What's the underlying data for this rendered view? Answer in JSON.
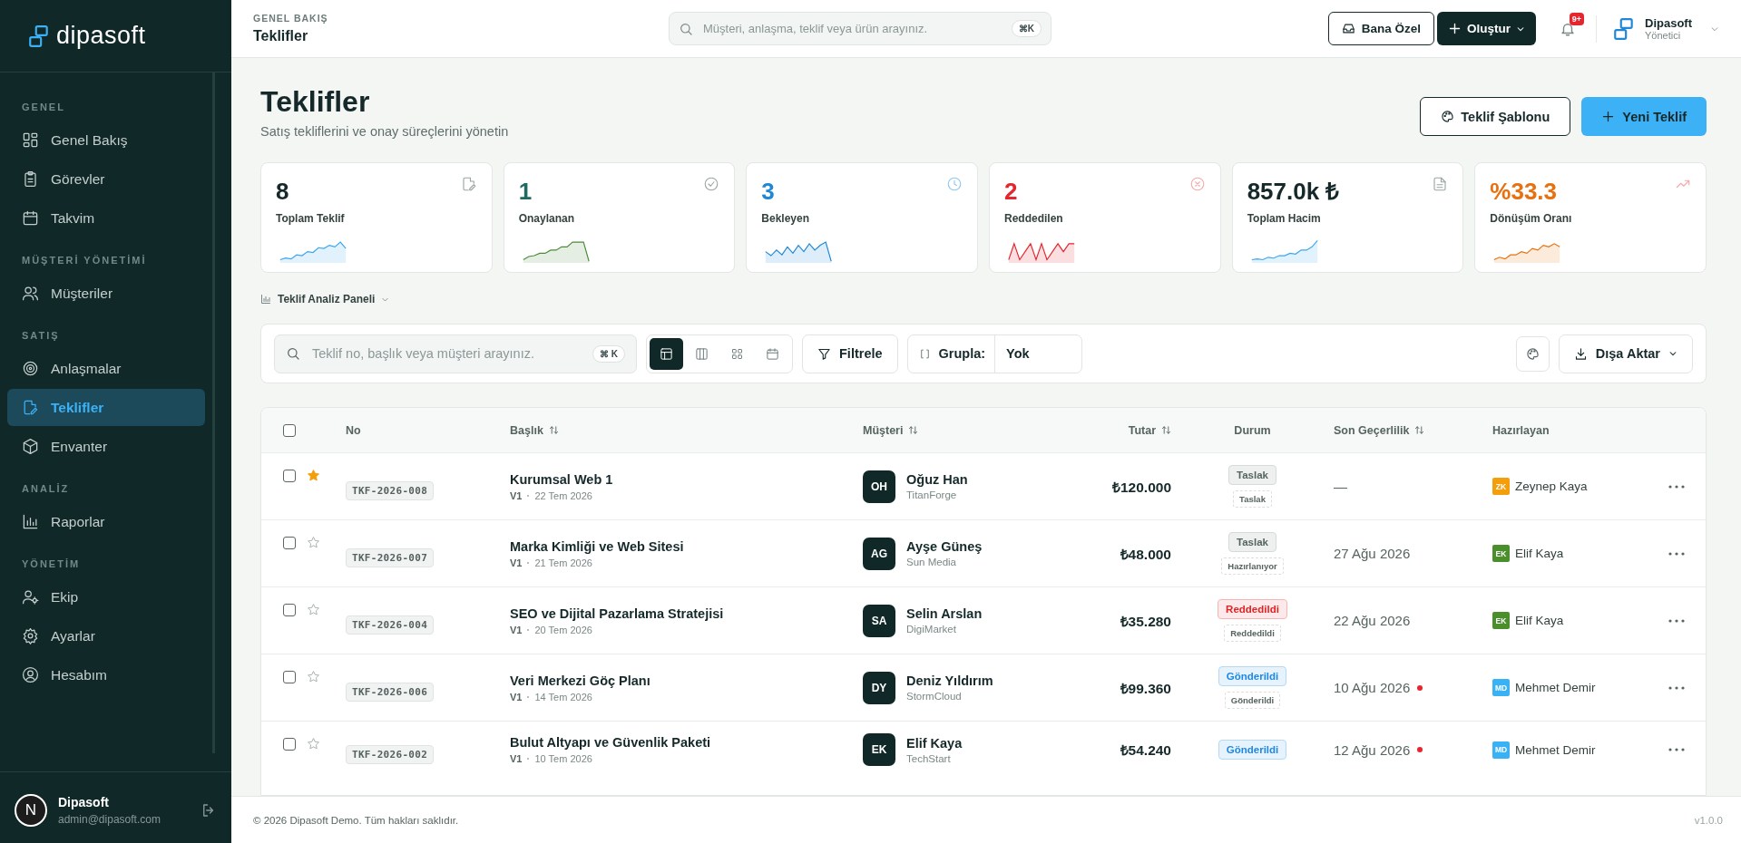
{
  "sidebar": {
    "brand": "dipasoft",
    "sections": [
      {
        "label": "GENEL",
        "items": [
          {
            "label": "Genel Bakış",
            "selected": false
          },
          {
            "label": "Görevler",
            "selected": false
          },
          {
            "label": "Takvim",
            "selected": false
          }
        ]
      },
      {
        "label": "MÜŞTERİ YÖNETİMİ",
        "items": [
          {
            "label": "Müşteriler",
            "selected": false
          }
        ]
      },
      {
        "label": "SATIŞ",
        "items": [
          {
            "label": "Anlaşmalar",
            "selected": false
          },
          {
            "label": "Teklifler",
            "selected": true
          },
          {
            "label": "Envanter",
            "selected": false
          }
        ]
      },
      {
        "label": "ANALİZ",
        "items": [
          {
            "label": "Raporlar",
            "selected": false
          }
        ]
      },
      {
        "label": "YÖNETİM",
        "items": [
          {
            "label": "Ekip",
            "selected": false
          },
          {
            "label": "Ayarlar",
            "selected": false
          },
          {
            "label": "Hesabım",
            "selected": false
          }
        ]
      }
    ],
    "user": {
      "initial": "N",
      "name": "Dipasoft",
      "email": "admin@dipasoft.com"
    }
  },
  "header": {
    "breadcrumb": "GENEL BAKIŞ",
    "title": "Teklifler",
    "search": {
      "placeholder": "Müşteri, anlaşma, teklif veya ürün arayınız.",
      "shortcut": "⌘K"
    },
    "personal_button": "Bana Özel",
    "create_button": "Oluştur",
    "notification_count": "9+",
    "account": {
      "name": "Dipasoft",
      "role": "Yönetici"
    }
  },
  "page": {
    "title": "Teklifler",
    "subtitle": "Satış tekliflerini ve onay süreçlerini yönetin",
    "template_button": "Teklif Şablonu",
    "new_button": "Yeni Teklif"
  },
  "stats": [
    {
      "value": "8",
      "label": "Toplam Teklif",
      "color": "#16292a"
    },
    {
      "value": "1",
      "label": "Onaylanan",
      "color": "#1f6b63"
    },
    {
      "value": "3",
      "label": "Bekleyen",
      "color": "#1e88d6"
    },
    {
      "value": "2",
      "label": "Reddedilen",
      "color": "#e5262e"
    },
    {
      "value": "857.0k ₺",
      "label": "Toplam Hacim",
      "color": "#16292a"
    },
    {
      "value": "%33.3",
      "label": "Dönüşüm Oranı",
      "color": "#e8700f"
    }
  ],
  "analysis_panel": {
    "label": "Teklif Analiz Paneli"
  },
  "toolbar": {
    "search": {
      "placeholder": "Teklif no, başlık veya müşteri arayınız.",
      "shortcut": "⌘ K"
    },
    "views": [
      {
        "selected": true
      },
      {
        "selected": false
      },
      {
        "selected": false
      },
      {
        "selected": false
      }
    ],
    "filter": "Filtrele",
    "group_label": "Grupla:",
    "group_value": "Yok",
    "export": "Dışa Aktar"
  },
  "table": {
    "select_all_checked": false,
    "columns": [
      {
        "label": "No",
        "sortable": false
      },
      {
        "label": "Başlık",
        "sortable": true
      },
      {
        "label": "Müşteri",
        "sortable": true
      },
      {
        "label": "Tutar",
        "sortable": true
      },
      {
        "label": "Durum",
        "sortable": false
      },
      {
        "label": "Son Geçerlilik",
        "sortable": true
      },
      {
        "label": "Hazırlayan",
        "sortable": false
      }
    ],
    "rows": [
      {
        "checked": false,
        "starred": true,
        "number": "TKF-2026-008",
        "title": "Kurumsal Web 1",
        "version": "V1",
        "date": "22 Tem 2026",
        "customer": {
          "initials": "OH",
          "name": "Oğuz Han",
          "company": "TitanForge"
        },
        "amount": "₺120.000",
        "status": {
          "kind": "draft",
          "label": "Taslak"
        },
        "substatus": "Taslak",
        "valid_until": "—",
        "overdue": false,
        "owner": {
          "initials": "ZK",
          "name": "Zeynep Kaya",
          "color": "#f59e0b"
        }
      },
      {
        "checked": false,
        "starred": false,
        "number": "TKF-2026-007",
        "title": "Marka Kimliği ve Web Sitesi",
        "version": "V1",
        "date": "21 Tem 2026",
        "customer": {
          "initials": "AG",
          "name": "Ayşe Güneş",
          "company": "Sun Media"
        },
        "amount": "₺48.000",
        "status": {
          "kind": "draft",
          "label": "Taslak"
        },
        "substatus": "Hazırlanıyor",
        "valid_until": "27 Ağu 2026",
        "overdue": false,
        "owner": {
          "initials": "EK",
          "name": "Elif Kaya",
          "color": "#4a8f2c"
        }
      },
      {
        "checked": false,
        "starred": false,
        "number": "TKF-2026-004",
        "title": "SEO ve Dijital Pazarlama Stratejisi",
        "version": "V1",
        "date": "20 Tem 2026",
        "customer": {
          "initials": "SA",
          "name": "Selin Arslan",
          "company": "DigiMarket"
        },
        "amount": "₺35.280",
        "status": {
          "kind": "rejected",
          "label": "Reddedildi"
        },
        "substatus": "Reddedildi",
        "valid_until": "22 Ağu 2026",
        "overdue": false,
        "owner": {
          "initials": "EK",
          "name": "Elif Kaya",
          "color": "#4a8f2c"
        }
      },
      {
        "checked": false,
        "starred": false,
        "number": "TKF-2026-006",
        "title": "Veri Merkezi Göç Planı",
        "version": "V1",
        "date": "14 Tem 2026",
        "customer": {
          "initials": "DY",
          "name": "Deniz Yıldırım",
          "company": "StormCloud"
        },
        "amount": "₺99.360",
        "status": {
          "kind": "sent",
          "label": "Gönderildi"
        },
        "substatus": "Gönderildi",
        "valid_until": "10 Ağu 2026",
        "overdue": true,
        "owner": {
          "initials": "MD",
          "name": "Mehmet Demir",
          "color": "#38b2f5"
        }
      },
      {
        "checked": false,
        "starred": false,
        "number": "TKF-2026-002",
        "title": "Bulut Altyapı ve Güvenlik Paketi",
        "version": "V1",
        "date": "10 Tem 2026",
        "customer": {
          "initials": "EK",
          "name": "Elif Kaya",
          "company": "TechStart"
        },
        "amount": "₺54.240",
        "status": {
          "kind": "sent",
          "label": "Gönderildi"
        },
        "valid_until": "12 Ağu 2026",
        "overdue": true,
        "owner": {
          "initials": "MD",
          "name": "Mehmet Demir",
          "color": "#38b2f5"
        }
      }
    ]
  },
  "footer": {
    "copyright": "© 2026 Dipasoft Demo. Tüm hakları saklıdır.",
    "version": "v1.0.0"
  }
}
